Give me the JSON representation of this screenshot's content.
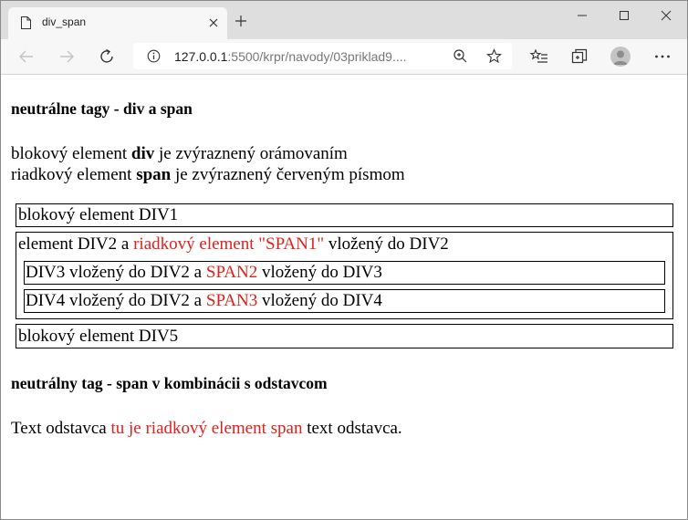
{
  "browser": {
    "tab_title": "div_span",
    "url_host": "127.0.0.1",
    "url_rest": ":5500/krpr/navody/03priklad9...."
  },
  "page": {
    "heading1": "neutrálne tagy - div a span",
    "intro1_pre": "blokový element ",
    "intro1_bold": "div",
    "intro1_post": " je zvýraznený orámovaním",
    "intro2_pre": "riadkový element ",
    "intro2_bold": "span",
    "intro2_post": " je zvýraznený červeným písmom",
    "div1": "blokový element DIV1",
    "div2_pre": "element DIV2 a ",
    "div2_span": "riadkový element \"SPAN1\"",
    "div2_post": " vložený do DIV2",
    "div3_pre": "DIV3 vložený do DIV2 a ",
    "div3_span": "SPAN2",
    "div3_post": " vložený do DIV3",
    "div4_pre": "DIV4 vložený do DIV2 a ",
    "div4_span": "SPAN3",
    "div4_post": " vložený do DIV4",
    "div5": "blokový element DIV5",
    "heading2": "neutrálny tag - span v kombinácii s odstavcom",
    "para_pre": "Text odstavca ",
    "para_span": "tu je riadkový element span",
    "para_post": " text odstavca."
  },
  "colors": {
    "span_red": "#e0201c"
  }
}
